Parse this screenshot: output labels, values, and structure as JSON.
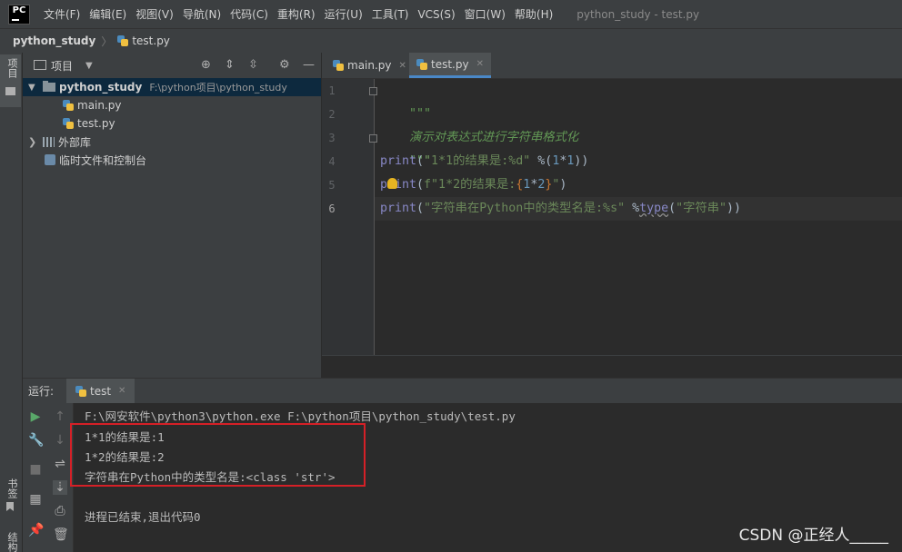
{
  "menubar": {
    "items": [
      "文件(F)",
      "编辑(E)",
      "视图(V)",
      "导航(N)",
      "代码(C)",
      "重构(R)",
      "运行(U)",
      "工具(T)",
      "VCS(S)",
      "窗口(W)",
      "帮助(H)"
    ],
    "window_title": "python_study - test.py",
    "logo_text": "PC"
  },
  "navbar": {
    "project": "python_study",
    "file": "test.py"
  },
  "left_strip": {
    "project_tab": "项目",
    "bookmarks_tab": "书签",
    "structure_tab": "结构"
  },
  "project_panel": {
    "title": "项目",
    "root_name": "python_study",
    "root_path": "F:\\python项目\\python_study",
    "files": [
      "main.py",
      "test.py"
    ],
    "external_libs": "外部库",
    "scratches": "临时文件和控制台"
  },
  "editor_tabs": [
    {
      "label": "main.py",
      "close": "✕"
    },
    {
      "label": "test.py",
      "close": "✕"
    }
  ],
  "code": {
    "line_numbers": [
      "1",
      "2",
      "3",
      "4",
      "5",
      "6"
    ],
    "l1": "\"\"\"",
    "l2": "演示对表达式进行字符串格式化",
    "l3": "\"\"\"",
    "l4_fn": "print",
    "l4_str": "\"1*1的结果是:%d\"",
    "l4_op": " %(",
    "l4_a": "1",
    "l4_star": "*",
    "l4_b": "1",
    "l4_end": "))",
    "l5_fn": "print",
    "l5_open": "(",
    "l5_fstr": "f\"1*2的结果是:",
    "l5_lb": "{",
    "l5_a": "1",
    "l5_star": "*",
    "l5_b": "2",
    "l5_rb": "}",
    "l5_q": "\"",
    "l5_end": ")",
    "l6_fn": "print",
    "l6_open": "(",
    "l6_str": "\"字符串在Python中的类型名是:%s\"",
    "l6_op": " %",
    "l6_type": "type",
    "l6_open2": "(",
    "l6_str2": "\"字符串\"",
    "l6_end": "))"
  },
  "run_panel": {
    "label": "运行:",
    "tab": "test",
    "tab_close": "✕",
    "console": [
      "F:\\网安软件\\python3\\python.exe F:\\python项目\\python_study\\test.py",
      "1*1的结果是:1",
      "1*2的结果是:2",
      "字符串在Python中的类型名是:<class 'str'>",
      "",
      "进程已结束,退出代码0"
    ]
  },
  "watermark": "CSDN @正经人_____",
  "colors": {
    "highlight_box": "#d52027",
    "tab_accent": "#4a88c7",
    "selection": "#0d293e"
  }
}
